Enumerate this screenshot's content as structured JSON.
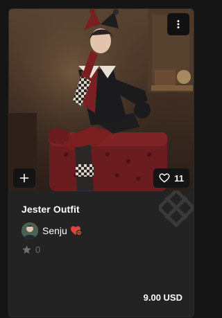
{
  "item": {
    "title": "Jester Outfit",
    "likes": "11",
    "rating": "0",
    "price": "9.00 USD"
  },
  "author": {
    "name": "Senju",
    "badge_icon": "heart-badge-icon",
    "badge_color": "#e0433f"
  },
  "icons": {
    "more": "vertical-dots-icon",
    "add": "plus-icon",
    "like": "heart-outline-icon",
    "rating": "star-icon"
  },
  "colors": {
    "card_bg": "#232323",
    "page_bg": "#151515",
    "muted": "#6f6f6f"
  }
}
